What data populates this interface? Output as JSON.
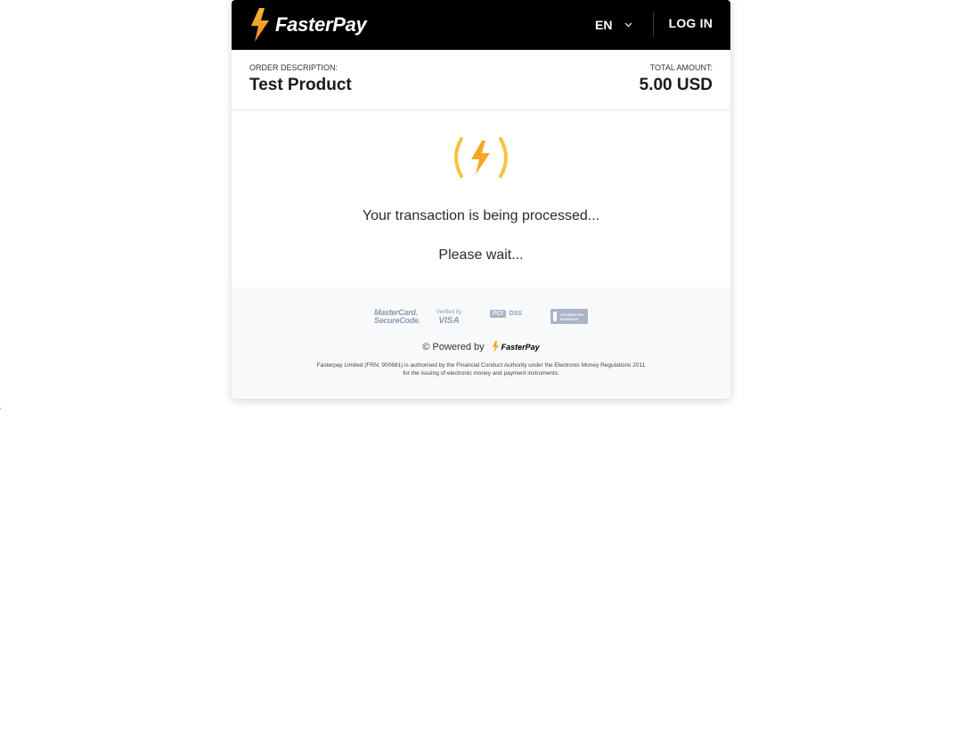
{
  "header": {
    "brand": "FasterPay",
    "language": "EN",
    "login_label": "LOG IN"
  },
  "order": {
    "description_label": "ORDER DESCRIPTION:",
    "description_value": "Test Product",
    "amount_label": "TOTAL AMOUNT:",
    "amount_value": "5.00 USD"
  },
  "status": {
    "processing_text": "Your transaction is being processed...",
    "wait_text": "Please wait..."
  },
  "footer": {
    "badges": {
      "mastercard_line1": "MasterCard.",
      "mastercard_line2": "SecureCode.",
      "visa_line1": "Verified by",
      "visa_line2": "VISA",
      "pci_mark": "PCI",
      "pci_text": "DSS",
      "bbb_text": "ACCREDITED BUSINESS"
    },
    "powered_by": "© Powered by",
    "powered_brand": "FasterPay",
    "legal": "Fasterpay Limited (FRN: 900681) is authorised by the Financial Conduct Authority under the Electronic Money Regulations 2011 for the issuing of electronic money and payment instruments."
  },
  "colors": {
    "brand_yellow": "#f5a623",
    "header_bg": "#000000",
    "footer_bg": "#f8f9fb"
  },
  "icons": {
    "brand": "lightning-bolt-icon",
    "spinner": "loading-bolt-icon",
    "language_dropdown": "chevron-down-icon"
  }
}
